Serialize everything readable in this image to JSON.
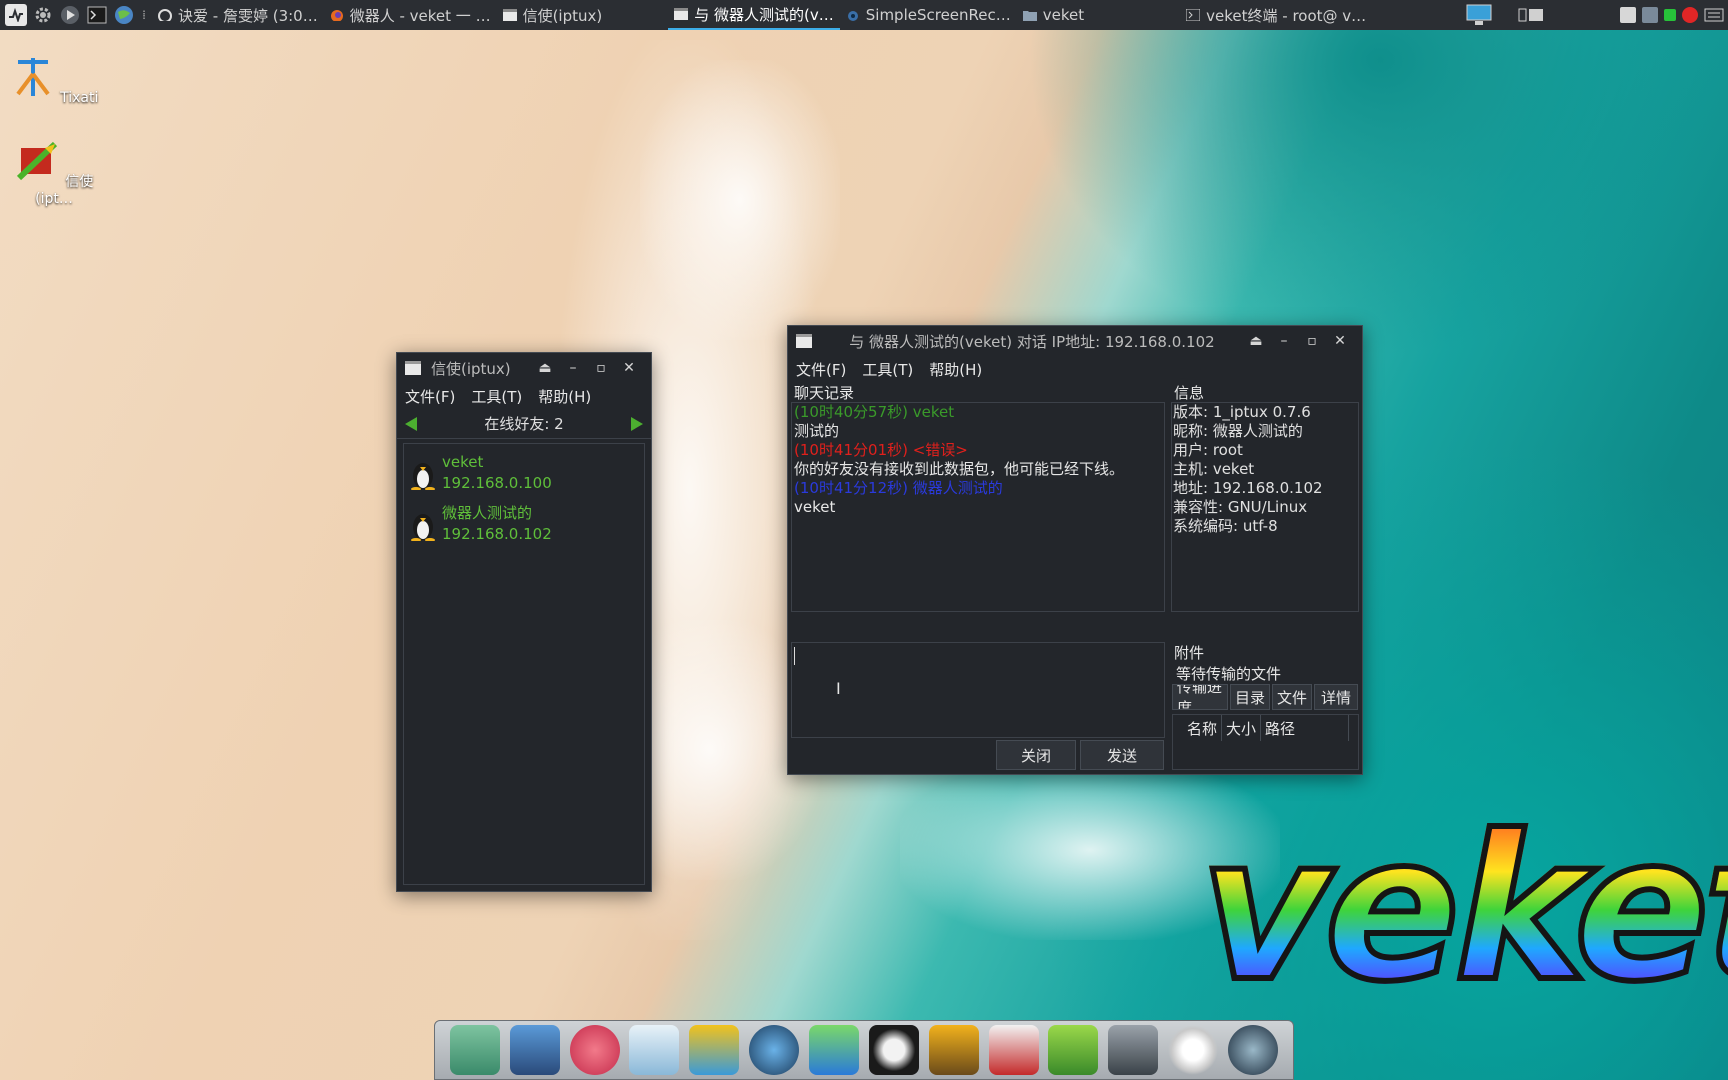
{
  "top_panel": {
    "tasks": [
      {
        "label": "诀爱 - 詹雯婷 (3:0…",
        "active": false
      },
      {
        "label": "微器人 - veket 一 …",
        "active": false
      },
      {
        "label": "信使(iptux)",
        "active": false
      },
      {
        "label": "与 微器人测试的(v…",
        "active": true
      },
      {
        "label": "SimpleScreenRec…",
        "active": false
      },
      {
        "label": "veket",
        "active": false
      },
      {
        "label": "veket终端 - root@ v…",
        "active": false
      }
    ]
  },
  "desktop": {
    "icons": [
      {
        "label": "Tixati"
      },
      {
        "label": "信使(ipt…"
      }
    ]
  },
  "iptux_window": {
    "title": "信使(iptux)",
    "menu": [
      "文件(F)",
      "工具(T)",
      "帮助(H)"
    ],
    "online_label": "在线好友: 2",
    "friends": [
      {
        "name": "veket",
        "ip": "192.168.0.100"
      },
      {
        "name": "微器人测试的",
        "ip": "192.168.0.102"
      }
    ]
  },
  "chat_window": {
    "title": "与 微器人测试的(veket) 对话 IP地址: 192.168.0.102",
    "menu": [
      "文件(F)",
      "工具(T)",
      "帮助(H)"
    ],
    "chat_history_label": "聊天记录",
    "messages": [
      {
        "text": "(10时40分57秒) veket",
        "color": "#3a9a2a"
      },
      {
        "text": "测试的",
        "color": "#e6e6e6"
      },
      {
        "text": "(10时41分01秒) <错误>",
        "color": "#e0201c"
      },
      {
        "text": "你的好友没有接收到此数据包，他可能已经下线。",
        "color": "#e6e6e6"
      },
      {
        "text": "(10时41分12秒) 微器人测试的",
        "color": "#2a3adc"
      },
      {
        "text": "veket",
        "color": "#e6e6e6"
      }
    ],
    "info_label": "信息",
    "info": [
      "版本: 1_iptux 0.7.6",
      "昵称: 微器人测试的",
      "用户: root",
      "主机: veket",
      "地址: 192.168.0.102",
      "兼容性: GNU/Linux",
      "系统编码: utf-8"
    ],
    "attachment_label": "附件",
    "pending_files_label": "等待传输的文件",
    "tabs": [
      "传输进度",
      "目录",
      "文件",
      "详情"
    ],
    "columns": [
      "名称",
      "大小",
      "路径"
    ],
    "close_button": "关闭",
    "send_button": "发送",
    "input_value": ""
  },
  "logo_text": "veket",
  "colors": {
    "panel_bg": "#2b2e33",
    "window_bg": "#23262b",
    "friend_green": "#5fbf3a",
    "active_task": "#3daee9"
  }
}
